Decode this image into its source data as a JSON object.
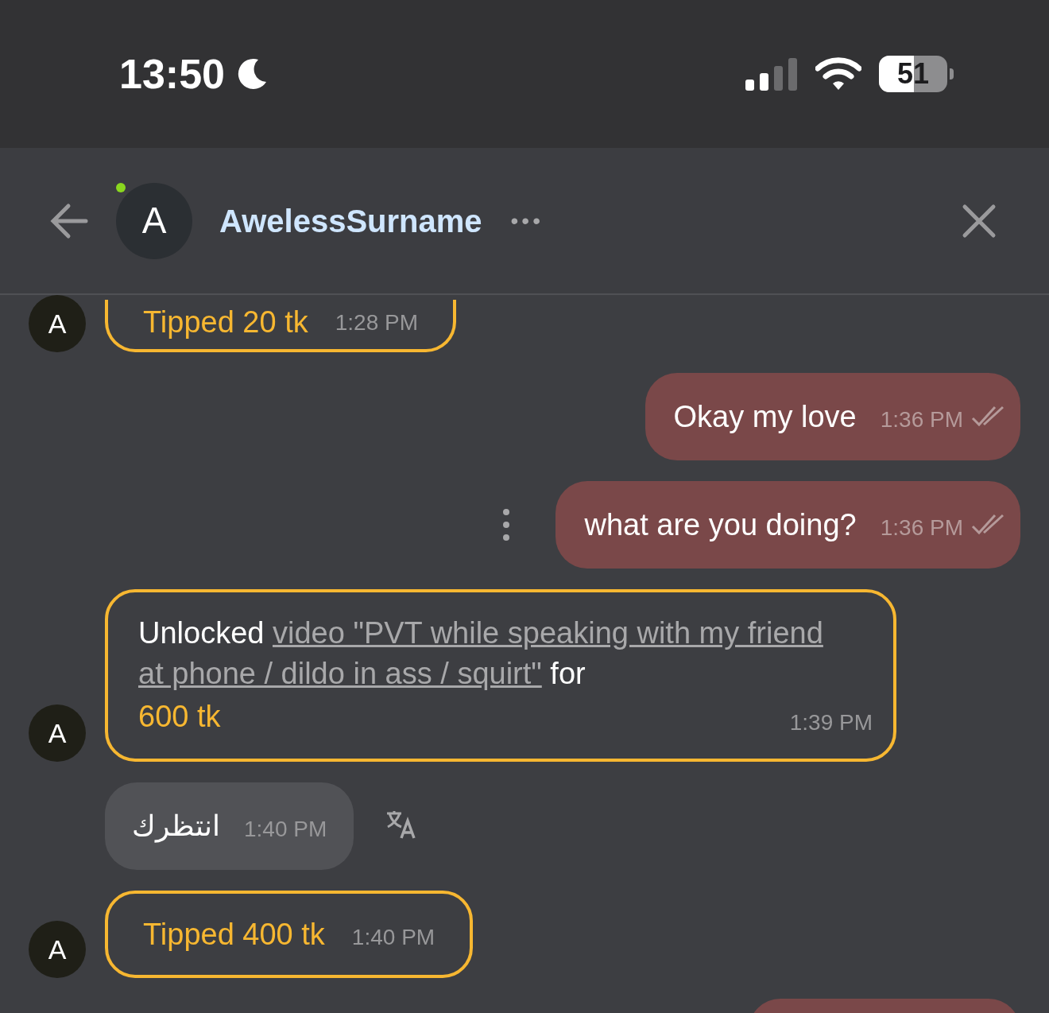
{
  "status_bar": {
    "time": "13:50",
    "battery": "51"
  },
  "header": {
    "avatar": "A",
    "online": true,
    "name": "AwelessSurname",
    "more": "•••"
  },
  "messages": [
    {
      "kind": "tip",
      "avatar": "A",
      "text": "Tipped 20 tk",
      "time": "1:28 PM"
    },
    {
      "kind": "sent",
      "text": "Okay my love",
      "time": "1:36 PM",
      "read": true,
      "menu": false
    },
    {
      "kind": "sent",
      "text": "what are you doing?",
      "time": "1:36 PM",
      "read": true,
      "menu": true
    },
    {
      "kind": "unlock",
      "avatar": "A",
      "prefix": "Unlocked",
      "link": "video \"PVT while speaking with my friend at phone / dildo in ass / squirt\"",
      "suffix": "for",
      "amount": "600 tk",
      "time": "1:39 PM"
    },
    {
      "kind": "received",
      "text": "انتظرك",
      "time": "1:40 PM",
      "translate": true
    },
    {
      "kind": "tip",
      "avatar": "A",
      "text": "Tipped 400 tk",
      "time": "1:40 PM"
    },
    {
      "kind": "sent_partial"
    }
  ]
}
